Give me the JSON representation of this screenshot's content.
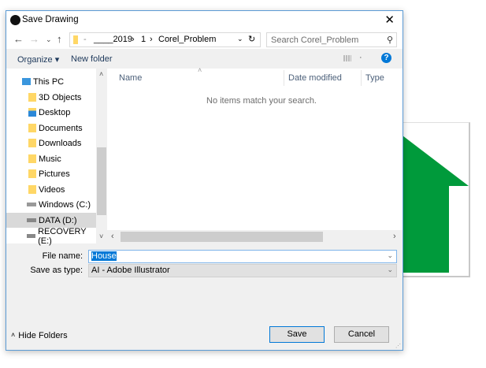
{
  "window": {
    "title": "Save Drawing",
    "close": "✕"
  },
  "address": {
    "segments": [
      "____2019",
      "1",
      "Corel_Problem"
    ],
    "sep": "›",
    "search_placeholder": "Search Corel_Problem"
  },
  "toolbar": {
    "organize": "Organize ▾",
    "new_folder": "New folder",
    "help": "?"
  },
  "nav": {
    "items": [
      {
        "label": "This PC"
      },
      {
        "label": "3D Objects"
      },
      {
        "label": "Desktop"
      },
      {
        "label": "Documents"
      },
      {
        "label": "Downloads"
      },
      {
        "label": "Music"
      },
      {
        "label": "Pictures"
      },
      {
        "label": "Videos"
      },
      {
        "label": "Windows (C:)"
      },
      {
        "label": "DATA (D:)",
        "selected": true
      },
      {
        "label": "RECOVERY (E:)"
      }
    ]
  },
  "list": {
    "columns": [
      "Name",
      "Date modified",
      "Type"
    ],
    "empty_message": "No items match your search."
  },
  "form": {
    "file_name_label": "File name:",
    "file_name_value": "House",
    "type_label": "Save as type:",
    "type_value": "AI - Adobe Illustrator"
  },
  "footer": {
    "hide_folders": "Hide Folders",
    "save": "Save",
    "cancel": "Cancel"
  },
  "colors": {
    "accent": "#0078d7",
    "house_green": "#009a3b"
  }
}
